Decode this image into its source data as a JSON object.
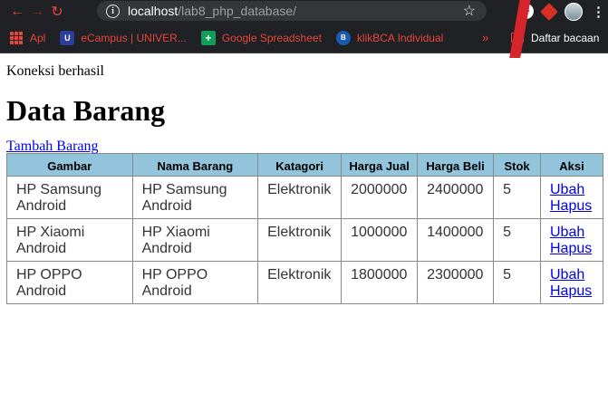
{
  "browser": {
    "url_host": "localhost",
    "url_path": "/lab8_php_database/",
    "bookmarks": [
      {
        "label": "Apl",
        "icon": "apps-grid-icon"
      },
      {
        "label": "eCampus | UNIVER...",
        "icon": "university-icon"
      },
      {
        "label": "Google Spreadsheet",
        "icon": "spreadsheet-icon"
      },
      {
        "label": "klikBCA Individual",
        "icon": "bca-icon"
      }
    ],
    "overflow_label": "»",
    "reading_list_label": "Daftar bacaan"
  },
  "page": {
    "status_text": "Koneksi berhasil",
    "title": "Data Barang",
    "add_link": "Tambah Barang"
  },
  "table": {
    "headers": [
      "Gambar",
      "Nama Barang",
      "Katagori",
      "Harga Jual",
      "Harga Beli",
      "Stok",
      "Aksi"
    ],
    "rows": [
      {
        "gambar": "HP Samsung Android",
        "nama": "HP Samsung Android",
        "kategori": "Elektronik",
        "harga_jual": "2000000",
        "harga_beli": "2400000",
        "stok": "5",
        "edit": "Ubah",
        "delete": "Hapus"
      },
      {
        "gambar": "HP Xiaomi Android",
        "nama": "HP Xiaomi Android",
        "kategori": "Elektronik",
        "harga_jual": "1000000",
        "harga_beli": "1400000",
        "stok": "5",
        "edit": "Ubah",
        "delete": "Hapus"
      },
      {
        "gambar": "HP OPPO Android",
        "nama": "HP OPPO Android",
        "kategori": "Elektronik",
        "harga_jual": "1800000",
        "harga_beli": "2300000",
        "stok": "5",
        "edit": "Ubah",
        "delete": "Hapus"
      }
    ]
  },
  "colors": {
    "header_bg": "#92c5dc",
    "link": "#0000ee",
    "chrome_bg": "#202124"
  }
}
